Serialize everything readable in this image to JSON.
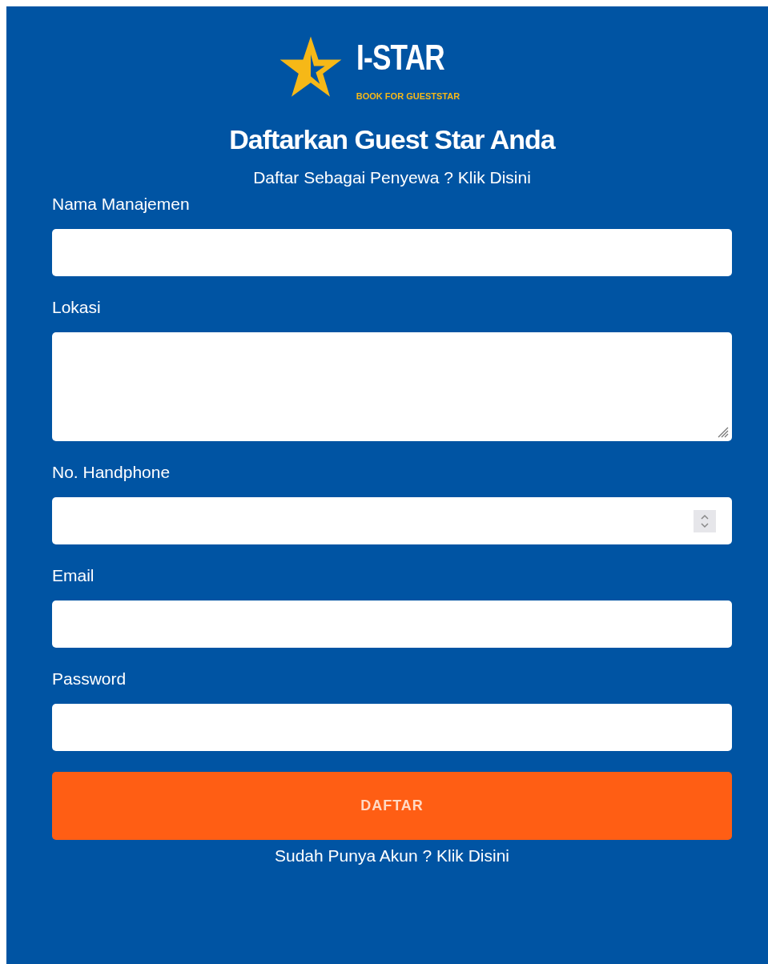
{
  "logo": {
    "title": "I-STAR",
    "tagline": "BOOK FOR GUESTSTAR"
  },
  "heading": "Daftarkan Guest Star Anda",
  "register_link": "Daftar Sebagai Penyewa ? Klik Disini",
  "fields": [
    {
      "label": "Nama Manajemen",
      "kind": "text"
    },
    {
      "label": "Lokasi",
      "kind": "textarea"
    },
    {
      "label": "No. Handphone",
      "kind": "number"
    },
    {
      "label": "Email",
      "kind": "email"
    },
    {
      "label": "Password",
      "kind": "password"
    }
  ],
  "submit": "DAFTAR",
  "login_link": "Sudah Punya Akun ? Klik Disini"
}
